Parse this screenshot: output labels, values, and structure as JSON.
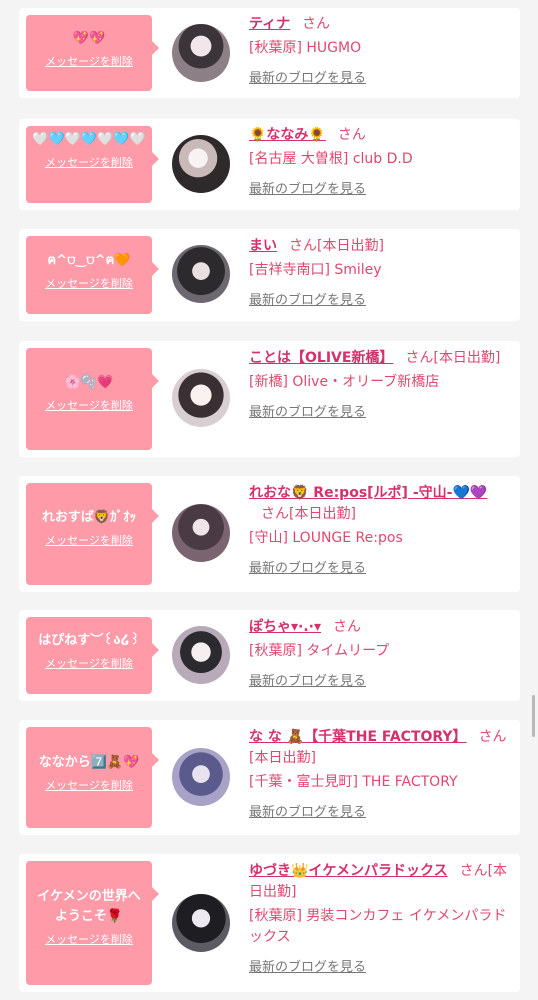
{
  "messages": [
    {
      "bubble": "💖💖",
      "name": "ティナ",
      "san": "さん",
      "shop": "[秋葉原] HUGMO"
    },
    {
      "bubble": "🤍🩵🤍🩵🤍🩵🤍",
      "name": "🌻ななみ🌻",
      "san": "さん",
      "shop": "[名古屋 大曽根] club D.D"
    },
    {
      "bubble": "ฅ^⩌‿⩌^ฅ🧡",
      "name": "まい",
      "san": "さん[本日出勤]",
      "shop": "[吉祥寺南口] Smiley"
    },
    {
      "bubble": "🌸🫧💗",
      "name": "ことは【OLIVE新橋】",
      "san": "さん[本日出勤]",
      "shop": "[新橋] Olive・オリーブ新橋店"
    },
    {
      "bubble": "れおすば🦁ｶﾞｵｯ",
      "name": "れおな🦁 Re:pos[ルポ] -守山-💙💜",
      "san": "さん[本日出勤]",
      "shop": "[守山] LOUNGE Re:pos"
    },
    {
      "bubble": "はぴねす︶꒰ა໒꒱",
      "name": "ぽちゃ▾·.·▾",
      "san": "さん",
      "shop": "[秋葉原] タイムリープ"
    },
    {
      "bubble": "ななから7️⃣🧸💖",
      "name": "な な 🧸【千葉THE FACTORY】",
      "san": "さん[本日出勤]",
      "shop": "[千葉・富士見町] THE FACTORY"
    },
    {
      "bubble": "イケメンの世界へようこそ🌹",
      "name": "ゆづき👑イケメンパラドックス",
      "san": "さん[本日出勤]",
      "shop": "[秋葉原] 男装コンカフェ イケメンパラドックス"
    }
  ],
  "labels": {
    "delete": "メッセージを削除",
    "blog": "最新のブログを見る"
  },
  "colors": {
    "bubble": "#ff9aa8",
    "name": "#d6306a",
    "shop": "#e0486f",
    "background": "#f4f4f4"
  }
}
